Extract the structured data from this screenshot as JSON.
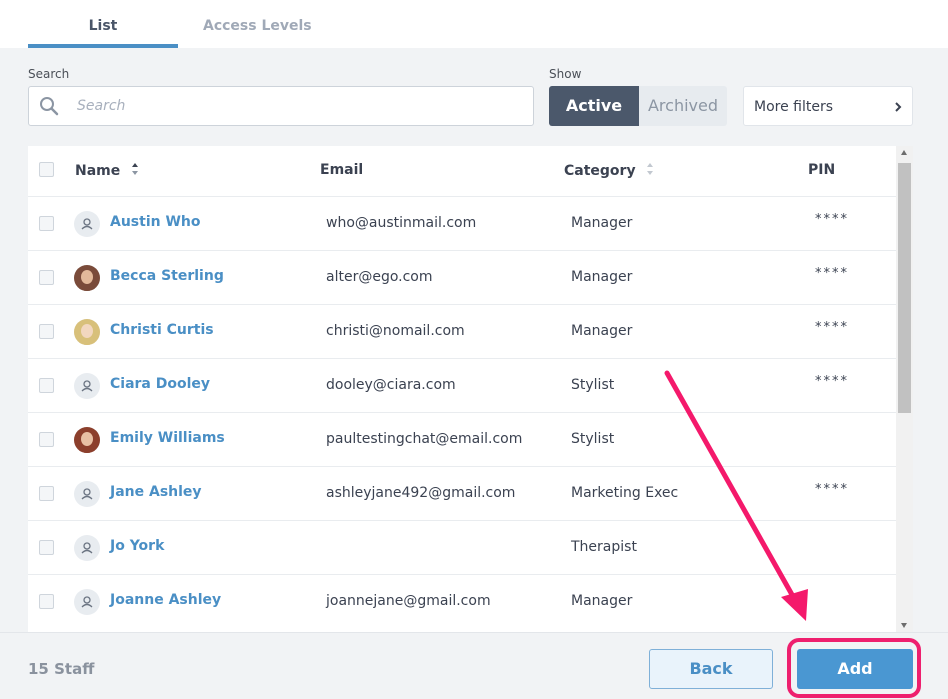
{
  "tabs": [
    {
      "label": "List",
      "active": true
    },
    {
      "label": "Access Levels",
      "active": false
    }
  ],
  "search": {
    "label": "Search",
    "placeholder": "Search",
    "value": ""
  },
  "show": {
    "label": "Show",
    "active_label": "Active",
    "archived_label": "Archived",
    "selected": "Active"
  },
  "more_filters": {
    "label": "More filters"
  },
  "table": {
    "columns": {
      "name": "Name",
      "email": "Email",
      "category": "Category",
      "pin": "PIN"
    },
    "rows": [
      {
        "name": "Austin Who",
        "email": "who@austinmail.com",
        "category": "Manager",
        "pin": "****",
        "avatar": "placeholder"
      },
      {
        "name": "Becca Sterling",
        "email": "alter@ego.com",
        "category": "Manager",
        "pin": "****",
        "avatar": "photo"
      },
      {
        "name": "Christi Curtis",
        "email": "christi@nomail.com",
        "category": "Manager",
        "pin": "****",
        "avatar": "photo"
      },
      {
        "name": "Ciara Dooley",
        "email": "dooley@ciara.com",
        "category": "Stylist",
        "pin": "****",
        "avatar": "placeholder"
      },
      {
        "name": "Emily Williams",
        "email": "paultestingchat@email.com",
        "category": "Stylist",
        "pin": "",
        "avatar": "photo"
      },
      {
        "name": "Jane Ashley",
        "email": "ashleyjane492@gmail.com",
        "category": "Marketing Exec",
        "pin": "****",
        "avatar": "placeholder"
      },
      {
        "name": "Jo York",
        "email": "",
        "category": "Therapist",
        "pin": "",
        "avatar": "placeholder"
      },
      {
        "name": "Joanne Ashley",
        "email": "joannejane@gmail.com",
        "category": "Manager",
        "pin": "",
        "avatar": "placeholder"
      }
    ]
  },
  "footer": {
    "staff_count": "15 Staff",
    "back_label": "Back",
    "add_label": "Add"
  },
  "colors": {
    "accent": "#4a8fc5",
    "active_segment": "#4b586b",
    "highlight": "#ee1f6e",
    "add_button": "#4a97d2"
  },
  "icons": [
    "search-icon",
    "sort-icon",
    "chevron-right-icon",
    "user-placeholder-icon",
    "annotation-arrow"
  ]
}
